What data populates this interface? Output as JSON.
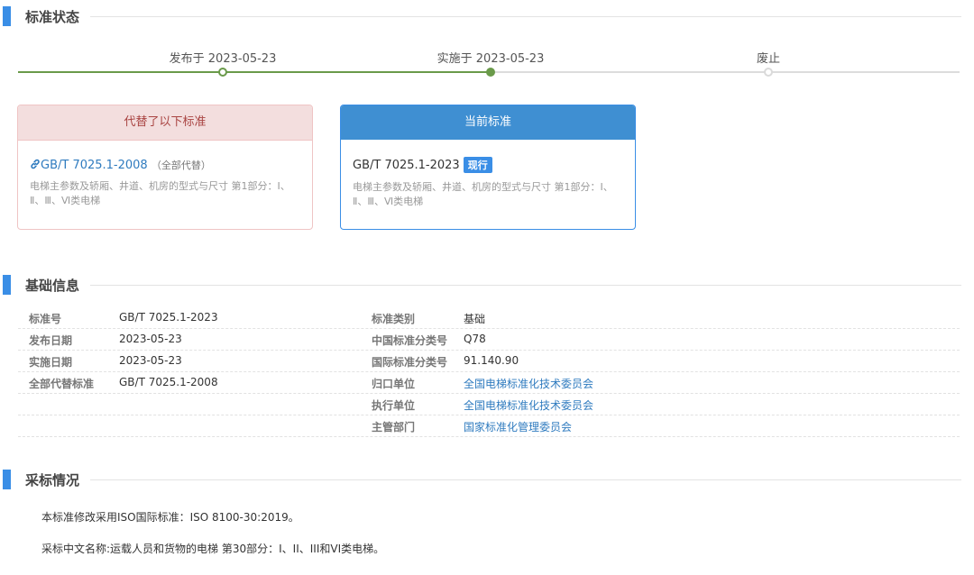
{
  "sections": {
    "status": "标准状态",
    "basic": "基础信息",
    "adoption": "采标情况"
  },
  "timeline": {
    "published": "发布于 2023-05-23",
    "implemented": "实施于 2023-05-23",
    "abolished": "废止"
  },
  "replaced_card": {
    "header": "代替了以下标准",
    "code": "GB/T 7025.1-2008",
    "note": "（全部代替）",
    "description": "电梯主参数及轿厢、井道、机房的型式与尺寸 第1部分：Ⅰ、Ⅱ、Ⅲ、Ⅵ类电梯"
  },
  "current_card": {
    "header": "当前标准",
    "code": "GB/T 7025.1-2023",
    "badge": "现行",
    "description": "电梯主参数及轿厢、井道、机房的型式与尺寸 第1部分：Ⅰ、Ⅱ、Ⅲ、Ⅵ类电梯"
  },
  "info": {
    "rows": [
      {
        "l1": "标准号",
        "v1": "GB/T 7025.1-2023",
        "l2": "标准类别",
        "v2": "基础"
      },
      {
        "l1": "发布日期",
        "v1": "2023-05-23",
        "l2": "中国标准分类号",
        "v2": "Q78"
      },
      {
        "l1": "实施日期",
        "v1": "2023-05-23",
        "l2": "国际标准分类号",
        "v2": "91.140.90"
      },
      {
        "l1": "全部代替标准",
        "v1": "GB/T 7025.1-2008",
        "l2": "归口单位",
        "v2": "全国电梯标准化技术委员会"
      },
      {
        "l1": "",
        "v1": "",
        "l2": "执行单位",
        "v2": "全国电梯标准化技术委员会"
      },
      {
        "l1": "",
        "v1": "",
        "l2": "主管部门",
        "v2": "国家标准化管理委员会"
      }
    ]
  },
  "adoption": {
    "line1": "本标准修改采用ISO国际标准：ISO 8100-30:2019。",
    "line2": "采标中文名称:运载人员和货物的电梯 第30部分：I、II、III和VI类电梯。"
  },
  "colors": {
    "accent": "#3a8ee6",
    "timeline": "#6a9a4a",
    "replaced_bg": "#f3dede",
    "replaced_text": "#a94442",
    "link": "#2f7bbf"
  },
  "icons": {
    "replaced_link": "link-icon"
  }
}
